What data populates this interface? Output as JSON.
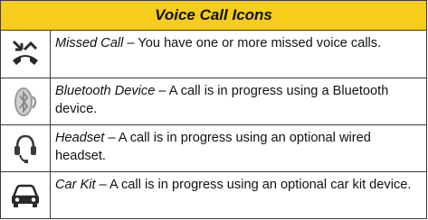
{
  "table": {
    "title": "Voice Call Icons",
    "rows": [
      {
        "icon": "missed-call-icon",
        "term": "Missed Call",
        "desc": " – You have one or more missed voice calls."
      },
      {
        "icon": "bluetooth-device-icon",
        "term": "Bluetooth Device",
        "desc": " – A call is in progress using a Bluetooth device."
      },
      {
        "icon": "headset-icon",
        "term": "Headset",
        "desc": " – A call is in progress using an optional wired headset."
      },
      {
        "icon": "car-kit-icon",
        "term": "Car Kit",
        "desc": " – A call is in progress using an optional car kit device."
      }
    ]
  },
  "colors": {
    "header_bg": "#f6cd1b",
    "border": "#3a3a3a",
    "icon_dark": "#2a2a2a",
    "icon_light": "#9a9a9a"
  }
}
